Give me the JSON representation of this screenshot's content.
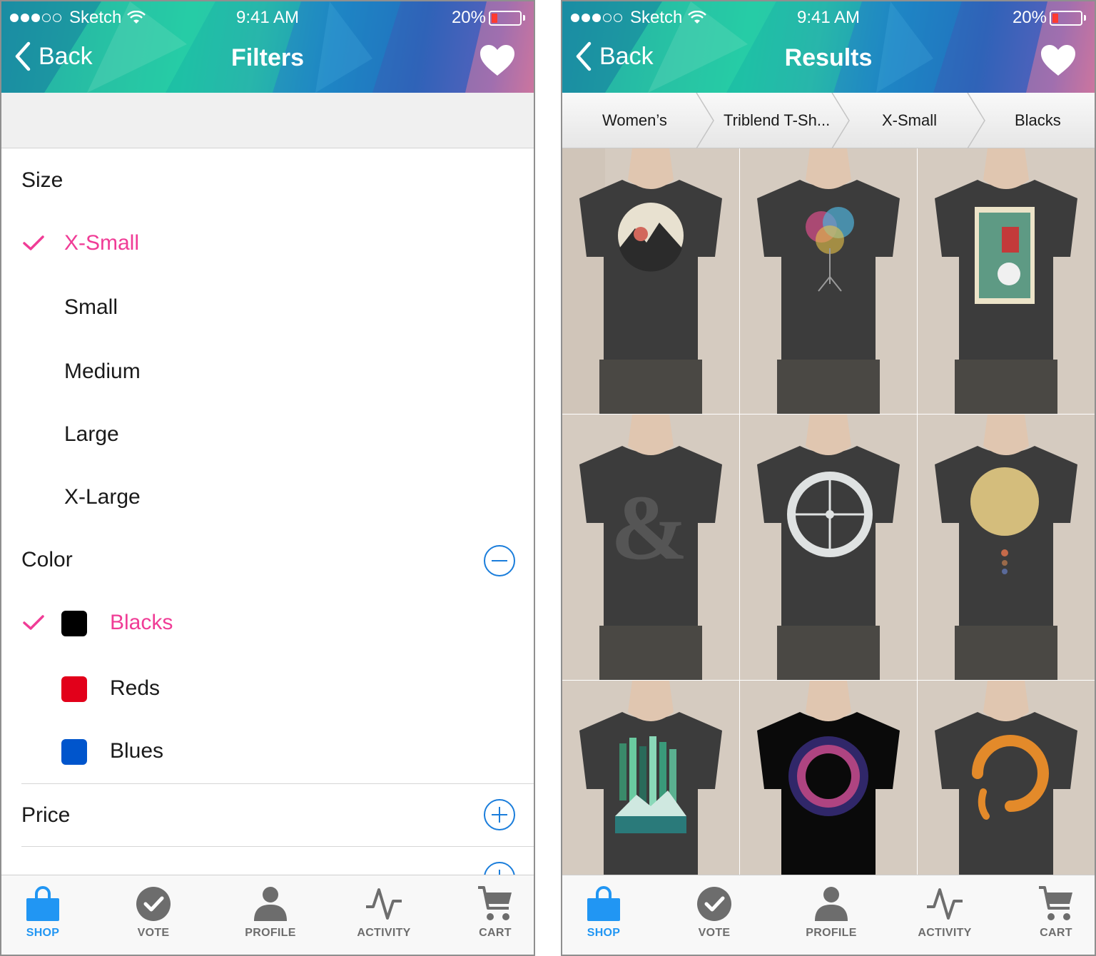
{
  "status_bar": {
    "carrier": "Sketch",
    "time": "9:41 AM",
    "battery": "20%",
    "signal_dots_filled": 3,
    "signal_dots_total": 5
  },
  "colors": {
    "accent_pink": "#f03c96",
    "accent_blue": "#1a7ddb",
    "tab_active": "#2196f3",
    "tab_inactive": "#6d6d6d"
  },
  "filters_screen": {
    "back_label": "Back",
    "title": "Filters",
    "size": {
      "heading": "Size",
      "options": [
        {
          "label": "X-Small",
          "selected": true
        },
        {
          "label": "Small",
          "selected": false
        },
        {
          "label": "Medium",
          "selected": false
        },
        {
          "label": "Large",
          "selected": false
        },
        {
          "label": "X-Large",
          "selected": false
        }
      ]
    },
    "color": {
      "heading": "Color",
      "expanded": true,
      "options": [
        {
          "label": "Blacks",
          "swatch": "#000000",
          "selected": true
        },
        {
          "label": "Reds",
          "swatch": "#e2001a",
          "selected": false
        },
        {
          "label": "Blues",
          "swatch": "#0055cc",
          "selected": false
        }
      ]
    },
    "price": {
      "heading": "Price",
      "expanded": false
    }
  },
  "results_screen": {
    "back_label": "Back",
    "title": "Results",
    "breadcrumbs": [
      "Women’s",
      "Triblend T-Sh...",
      "X-Small",
      "Blacks"
    ],
    "products": [
      {
        "design": "vinyl-record-mountains",
        "shirt_color": "#3c3c3c"
      },
      {
        "design": "rainbow-tree",
        "shirt_color": "#3c3c3c"
      },
      {
        "design": "robot-ramen-poster",
        "shirt_color": "#3c3c3c"
      },
      {
        "design": "ampersand-peace-heart",
        "shirt_color": "#3c3c3c"
      },
      {
        "design": "clock-window-silhouette",
        "shirt_color": "#3c3c3c"
      },
      {
        "design": "gold-sun-planets",
        "shirt_color": "#3c3c3c"
      },
      {
        "design": "northern-lights-mountains",
        "shirt_color": "#3c3c3c"
      },
      {
        "design": "cosmic-eclipse",
        "shirt_color": "#0a0a0a"
      },
      {
        "design": "orange-koi-enso",
        "shirt_color": "#3c3c3c"
      }
    ]
  },
  "tab_bar": [
    {
      "label": "SHOP",
      "icon": "shopping-bag-icon",
      "active": true
    },
    {
      "label": "VOTE",
      "icon": "vote-check-icon",
      "active": false
    },
    {
      "label": "PROFILE",
      "icon": "person-icon",
      "active": false
    },
    {
      "label": "ACTIVITY",
      "icon": "activity-pulse-icon",
      "active": false
    },
    {
      "label": "CART",
      "icon": "cart-icon",
      "active": false
    }
  ]
}
